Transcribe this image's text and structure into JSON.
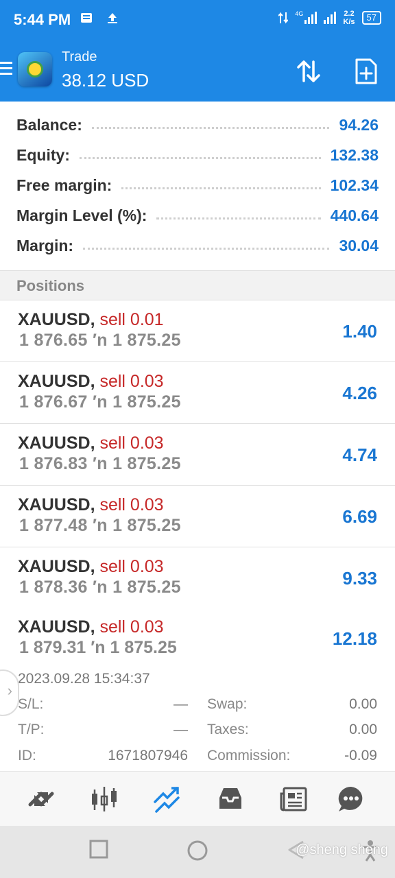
{
  "status_bar": {
    "time": "5:44 PM",
    "network": "4G",
    "speed_value": "2.2",
    "speed_unit": "K/s",
    "battery": "57"
  },
  "app_bar": {
    "title": "Trade",
    "subtitle": "38.12 USD",
    "icons": [
      "menu-icon",
      "app-logo",
      "sort-icon",
      "new-order-icon"
    ]
  },
  "summary": [
    {
      "label": "Balance:",
      "value": "94.26"
    },
    {
      "label": "Equity:",
      "value": "132.38"
    },
    {
      "label": "Free margin:",
      "value": "102.34"
    },
    {
      "label": "Margin Level (%):",
      "value": "440.64"
    },
    {
      "label": "Margin:",
      "value": "30.04"
    }
  ],
  "positions_header": "Positions",
  "positions": [
    {
      "symbol": "XAUUSD,",
      "side": "sell 0.01",
      "prices": "1 876.65 ′n  1 875.25",
      "profit": "1.40"
    },
    {
      "symbol": "XAUUSD,",
      "side": "sell 0.03",
      "prices": "1 876.67 ′n  1 875.25",
      "profit": "4.26"
    },
    {
      "symbol": "XAUUSD,",
      "side": "sell 0.03",
      "prices": "1 876.83 ′n  1 875.25",
      "profit": "4.74"
    },
    {
      "symbol": "XAUUSD,",
      "side": "sell 0.03",
      "prices": "1 877.48 ′n  1 875.25",
      "profit": "6.69"
    },
    {
      "symbol": "XAUUSD,",
      "side": "sell 0.03",
      "prices": "1 878.36 ′n  1 875.25",
      "profit": "9.33"
    }
  ],
  "expanded_position": {
    "symbol": "XAUUSD,",
    "side": "sell 0.03",
    "prices": "1 879.31 ′n  1 875.25",
    "profit": "12.18",
    "datetime": "2023.09.28 15:34:37",
    "sl_label": "S/L:",
    "sl_value": "—",
    "tp_label": "T/P:",
    "tp_value": "—",
    "id_label": "ID:",
    "id_value": "1671807946",
    "swap_label": "Swap:",
    "swap_value": "0.00",
    "taxes_label": "Taxes:",
    "taxes_value": "0.00",
    "commission_label": "Commission:",
    "commission_value": "-0.09"
  },
  "bottom_nav": {
    "items": [
      "quotes-icon",
      "chart-icon",
      "trade-icon",
      "history-icon",
      "news-icon",
      "messages-icon"
    ],
    "active": "trade-icon",
    "active_color": "#1e88e5",
    "inactive_color": "#555555"
  },
  "system_nav": {
    "watermark": "@sheng sheng"
  },
  "colors": {
    "brand": "#1e88e5",
    "value": "#1976d2",
    "sell": "#c62828"
  }
}
